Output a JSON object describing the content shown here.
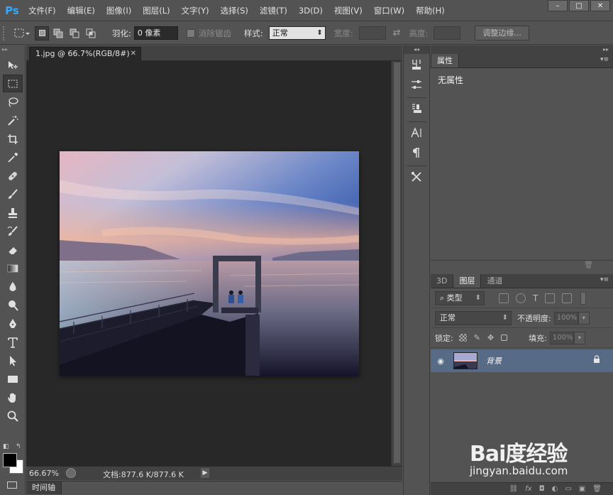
{
  "app": {
    "logo": "Ps",
    "menu": [
      "文件(F)",
      "编辑(E)",
      "图像(I)",
      "图层(L)",
      "文字(Y)",
      "选择(S)",
      "滤镜(T)",
      "3D(D)",
      "视图(V)",
      "窗口(W)",
      "帮助(H)"
    ],
    "window_buttons": [
      "–",
      "□",
      "✕"
    ]
  },
  "options": {
    "feather_label": "羽化:",
    "feather_value": "0 像素",
    "antialias_label": "消除锯齿",
    "style_label": "样式:",
    "style_value": "正常",
    "width_label": "宽度:",
    "height_label": "高度:",
    "refine_button": "调整边缘..."
  },
  "document": {
    "tab_title": "1.jpg @ 66.7%(RGB/8#)",
    "close_glyph": "✕",
    "zoom": "66.67%",
    "doc_info": "文档:877.6 K/877.6 K",
    "timeline_label": "时间轴"
  },
  "properties": {
    "tab": "属性",
    "body": "无属性"
  },
  "layers": {
    "tabs": [
      "3D",
      "图层",
      "通道"
    ],
    "filter_kind": "类型",
    "blend_mode": "正常",
    "opacity_label": "不透明度:",
    "opacity_value": "100%",
    "lock_label": "锁定:",
    "fill_label": "填充:",
    "fill_value": "100%",
    "layer_name": "背景",
    "footer_icons": [
      "link-icon",
      "fx-icon",
      "mask-icon",
      "adjustment-icon",
      "folder-icon",
      "new-layer-icon",
      "trash-icon"
    ]
  },
  "watermark": {
    "brand": "Bai度经验",
    "url": "jingyan.baidu.com"
  },
  "colors": {
    "ps_blue": "#31a8ff",
    "selected_layer": "#586b86",
    "canvas_bg": "#282828",
    "ui_gray": "#535353"
  }
}
